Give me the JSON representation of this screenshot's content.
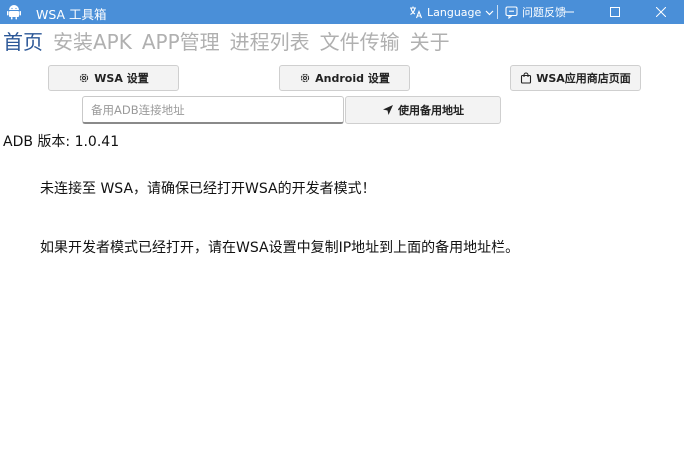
{
  "titlebar": {
    "title": "WSA 工具箱",
    "language_label": "Language",
    "feedback_label": "问题反馈"
  },
  "nav": {
    "tabs": [
      {
        "label": "首页",
        "active": true
      },
      {
        "label": "安装APK",
        "active": false
      },
      {
        "label": "APP管理",
        "active": false
      },
      {
        "label": "进程列表",
        "active": false
      },
      {
        "label": "文件传输",
        "active": false
      },
      {
        "label": "关于",
        "active": false
      }
    ]
  },
  "toolbar": {
    "wsa_settings_label": "WSA 设置",
    "android_settings_label": "Android 设置",
    "wsa_store_label": "WSA应用商店页面",
    "use_backup_label": "使用备用地址"
  },
  "adb_input": {
    "placeholder": "备用ADB连接地址",
    "value": ""
  },
  "main": {
    "adb_version": "ADB 版本: 1.0.41",
    "message_not_connected": "未连接至 WSA，请确保已经打开WSA的开发者模式！",
    "message_hint": "如果开发者模式已经打开，请在WSA设置中复制IP地址到上面的备用地址栏。"
  },
  "colors": {
    "titlebar_bg": "#4a8fd8",
    "active_tab": "#2b5797",
    "inactive_tab": "#b0b0b0"
  }
}
